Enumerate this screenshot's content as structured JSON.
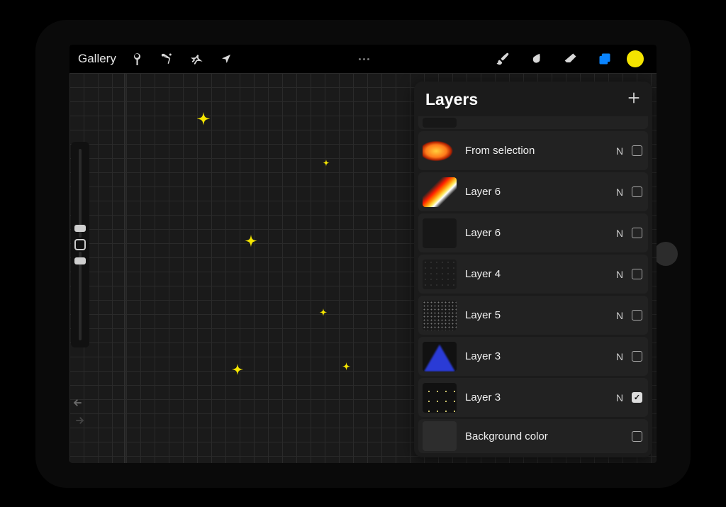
{
  "toolbar": {
    "gallery_label": "Gallery"
  },
  "panel": {
    "title": "Layers"
  },
  "layers": [
    {
      "name": "From selection",
      "blend": "N",
      "checked": false
    },
    {
      "name": "Layer 6",
      "blend": "N",
      "checked": false
    },
    {
      "name": "Layer 6",
      "blend": "N",
      "checked": false
    },
    {
      "name": "Layer 4",
      "blend": "N",
      "checked": false
    },
    {
      "name": "Layer 5",
      "blend": "N",
      "checked": false
    },
    {
      "name": "Layer 3",
      "blend": "N",
      "checked": false
    },
    {
      "name": "Layer 3",
      "blend": "N",
      "checked": true
    },
    {
      "name": "Background color",
      "blend": "",
      "checked": false
    }
  ],
  "colors": {
    "active_color": "#f4e400"
  }
}
